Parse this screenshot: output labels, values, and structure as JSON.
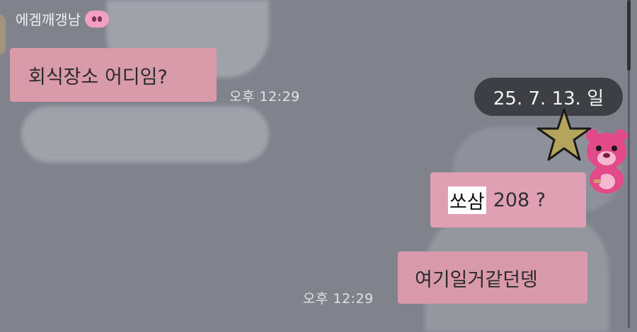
{
  "chat": {
    "sender_name": "에겜깨갱남",
    "sender_emoji": "pig-nose-emoji",
    "messages": [
      {
        "direction": "incoming",
        "text": "회식장소 어디임?",
        "time": "오후 12:29"
      },
      {
        "direction": "outgoing",
        "highlight_text": "쏘삼",
        "text": "208 ?"
      },
      {
        "direction": "outgoing",
        "text": "여기일거같던뎅",
        "time": "오후 12:29"
      }
    ],
    "date_badge": "25. 7. 13. 일"
  },
  "decor": {
    "stickers": [
      "star-sticker",
      "pink-bear-sticker"
    ]
  },
  "colors": {
    "background": "#80838c",
    "bubble": "#d99aaa",
    "date_badge_bg": "#3d3f45",
    "highlight": "#ffffff"
  }
}
